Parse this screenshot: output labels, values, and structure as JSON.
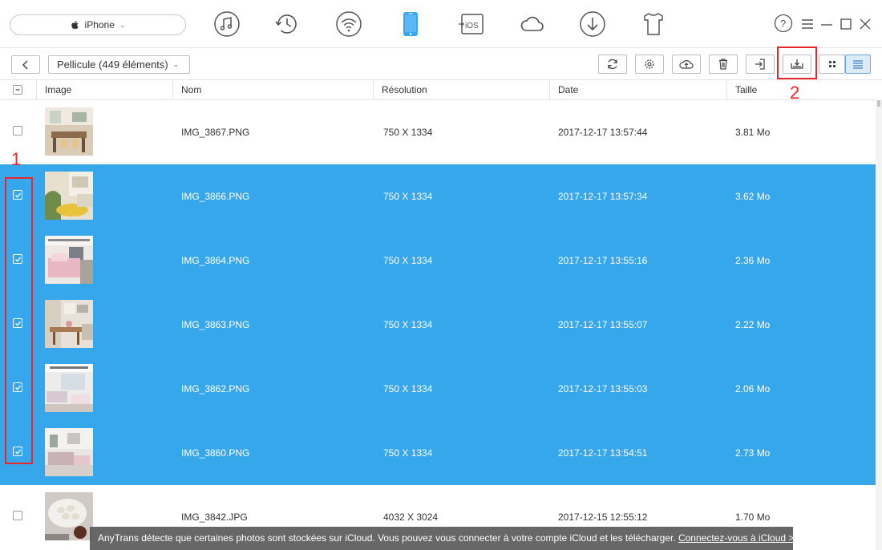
{
  "device": {
    "name": "iPhone"
  },
  "top_icons": [
    "music-icon",
    "history-icon",
    "wifi-icon",
    "phone-icon",
    "ios-icon",
    "cloud-icon",
    "download-icon",
    "tshirt-icon"
  ],
  "window_controls": [
    "help-icon",
    "menu-icon",
    "minimize-icon",
    "maximize-icon",
    "close-icon"
  ],
  "toolbar": {
    "album_label": "Pellicule (449 éléments)",
    "buttons": [
      "refresh-icon",
      "settings-icon",
      "upload-icon",
      "delete-icon",
      "import-icon",
      "export-to-pc-icon",
      "grid-view-icon",
      "list-view-icon"
    ],
    "active_view": "list"
  },
  "annotations": {
    "label_1": "1",
    "label_2": "2"
  },
  "table": {
    "columns": [
      "Image",
      "Nom",
      "Résolution",
      "Date",
      "Taille"
    ],
    "rows": [
      {
        "name": "IMG_3867.PNG",
        "resolution": "750 X 1334",
        "date": "2017-12-17 13:57:44",
        "size": "3.81 Mo",
        "selected": false
      },
      {
        "name": "IMG_3866.PNG",
        "resolution": "750 X 1334",
        "date": "2017-12-17 13:57:34",
        "size": "3.62 Mo",
        "selected": true
      },
      {
        "name": "IMG_3864.PNG",
        "resolution": "750 X 1334",
        "date": "2017-12-17 13:55:16",
        "size": "2.36 Mo",
        "selected": true
      },
      {
        "name": "IMG_3863.PNG",
        "resolution": "750 X 1334",
        "date": "2017-12-17 13:55:07",
        "size": "2.22 Mo",
        "selected": true
      },
      {
        "name": "IMG_3862.PNG",
        "resolution": "750 X 1334",
        "date": "2017-12-17 13:55:03",
        "size": "2.06 Mo",
        "selected": true
      },
      {
        "name": "IMG_3860.PNG",
        "resolution": "750 X 1334",
        "date": "2017-12-17 13:54:51",
        "size": "2.73 Mo",
        "selected": true
      },
      {
        "name": "IMG_3842.JPG",
        "resolution": "4032 X 3024",
        "date": "2017-12-15 12:55:12",
        "size": "1.70 Mo",
        "selected": false
      }
    ]
  },
  "notice": {
    "text": "AnyTrans détecte que certaines photos sont stockées sur iCloud. Vous pouvez vous connecter à votre compte iCloud et les télécharger. ",
    "link": "Connectez-vous à iCloud >"
  },
  "colors": {
    "selection": "#37a7ec",
    "annotation": "#e8262b",
    "active_view": "#dcebf8"
  }
}
